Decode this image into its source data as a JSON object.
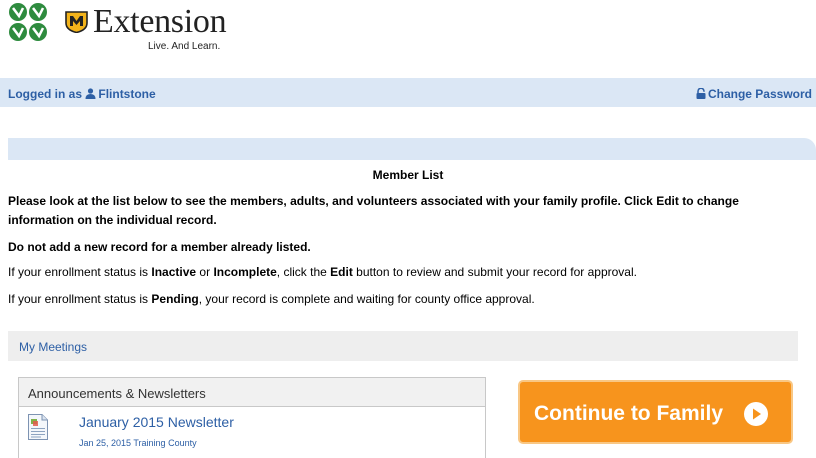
{
  "header": {
    "org_name": "Extension",
    "tagline": "Live. And Learn."
  },
  "login_bar": {
    "prefix": "Logged in as",
    "username": "Flintstone",
    "change_password": "Change Password",
    "user_icon": "user-icon",
    "lock_icon": "lock-icon"
  },
  "member_list": {
    "title": "Member List",
    "intro_a": "Please look at the list below to see the members, adults, and volunteers associated with your family profile. Click ",
    "intro_edit": "Edit",
    "intro_b": " to change information on the individual record.",
    "no_duplicate": "Do not add a new record for a member already listed.",
    "status1_a": "If your enrollment status is ",
    "status1_inactive": "Inactive",
    "status1_or": " or ",
    "status1_incomplete": "Incomplete",
    "status1_b": ", click the ",
    "status1_edit": "Edit",
    "status1_c": " button to review and submit your record for approval.",
    "status2_a": "If your enrollment status is ",
    "status2_pending": "Pending",
    "status2_b": ", your record is complete and waiting for county office approval."
  },
  "meetings": {
    "label": "My Meetings"
  },
  "announcements": {
    "heading": "Announcements & Newsletters",
    "items": [
      {
        "title": "January 2015 Newsletter",
        "meta": "Jan 25, 2015 Training County",
        "icon": "document-icon"
      }
    ]
  },
  "continue_button": {
    "label": "Continue to Family",
    "icon": "arrow-circle-right-icon"
  },
  "colors": {
    "link_blue": "#2d5fa5",
    "bar_blue": "#dbe7f5",
    "button_orange": "#f7941d",
    "clover_green": "#2e8b3e",
    "shield_gold": "#f2b31b"
  }
}
